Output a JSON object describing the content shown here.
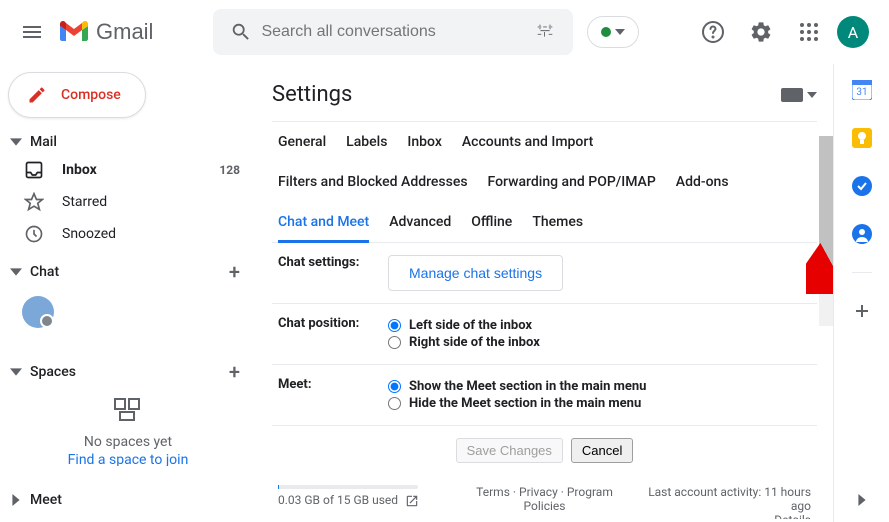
{
  "header": {
    "app_name": "Gmail",
    "search_placeholder": "Search all conversations",
    "avatar_letter": "A"
  },
  "sidebar": {
    "compose": "Compose",
    "mail_label": "Mail",
    "inbox": "Inbox",
    "inbox_count": "128",
    "starred": "Starred",
    "snoozed": "Snoozed",
    "chat_label": "Chat",
    "spaces_label": "Spaces",
    "spaces_empty": "No spaces yet",
    "spaces_link": "Find a space to join",
    "meet_label": "Meet"
  },
  "settings": {
    "title": "Settings",
    "tabs": {
      "general": "General",
      "labels": "Labels",
      "inbox": "Inbox",
      "accounts": "Accounts and Import",
      "filters": "Filters and Blocked Addresses",
      "forwarding": "Forwarding and POP/IMAP",
      "addons": "Add-ons",
      "chatmeet": "Chat and Meet",
      "advanced": "Advanced",
      "offline": "Offline",
      "themes": "Themes"
    },
    "chat_settings_label": "Chat settings:",
    "manage_btn": "Manage chat settings",
    "chat_position_label": "Chat position:",
    "chat_left": "Left side of the inbox",
    "chat_right": "Right side of the inbox",
    "meet_label": "Meet:",
    "meet_show": "Show the Meet section in the main menu",
    "meet_hide": "Hide the Meet section in the main menu",
    "save": "Save Changes",
    "cancel": "Cancel"
  },
  "footer": {
    "storage": "0.03 GB of 15 GB used",
    "terms": "Terms",
    "privacy": "Privacy",
    "program": "Program Policies",
    "activity": "Last account activity: 11 hours ago",
    "details": "Details"
  }
}
